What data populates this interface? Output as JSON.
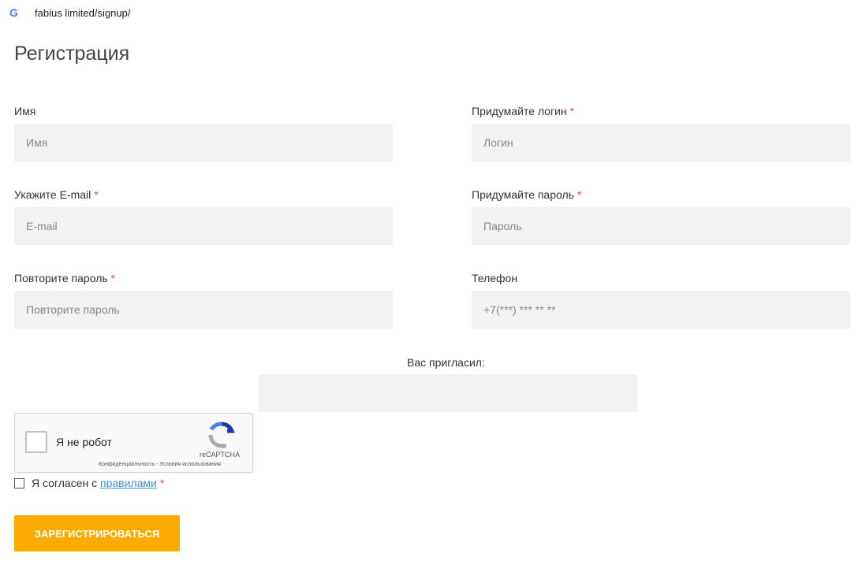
{
  "browser": {
    "url": "fabius limited/signup/",
    "favicon": "G"
  },
  "title": "Регистрация",
  "fields": {
    "name": {
      "label": "Имя",
      "placeholder": "Имя"
    },
    "login": {
      "label": "Придумайте логин",
      "placeholder": "Логин"
    },
    "email": {
      "label": "Укажите E-mail",
      "placeholder": "E-mail"
    },
    "password": {
      "label": "Придумайте пароль",
      "placeholder": "Пароль"
    },
    "password2": {
      "label": "Повторите пароль",
      "placeholder": "Повторите пароль"
    },
    "phone": {
      "label": "Телефон",
      "placeholder": "+7(***) *** ** **"
    },
    "referrer": {
      "label": "Вас пригласил:",
      "placeholder": ""
    }
  },
  "required_mark": "*",
  "captcha": {
    "label": "Я не робот",
    "brand": "reCAPTCHA",
    "links": "Конфиденциальность - Условия использования"
  },
  "agree": {
    "text": "Я согласен с ",
    "link": "правилами"
  },
  "submit": "ЗАРЕГИСТРИРОВАТЬСЯ"
}
